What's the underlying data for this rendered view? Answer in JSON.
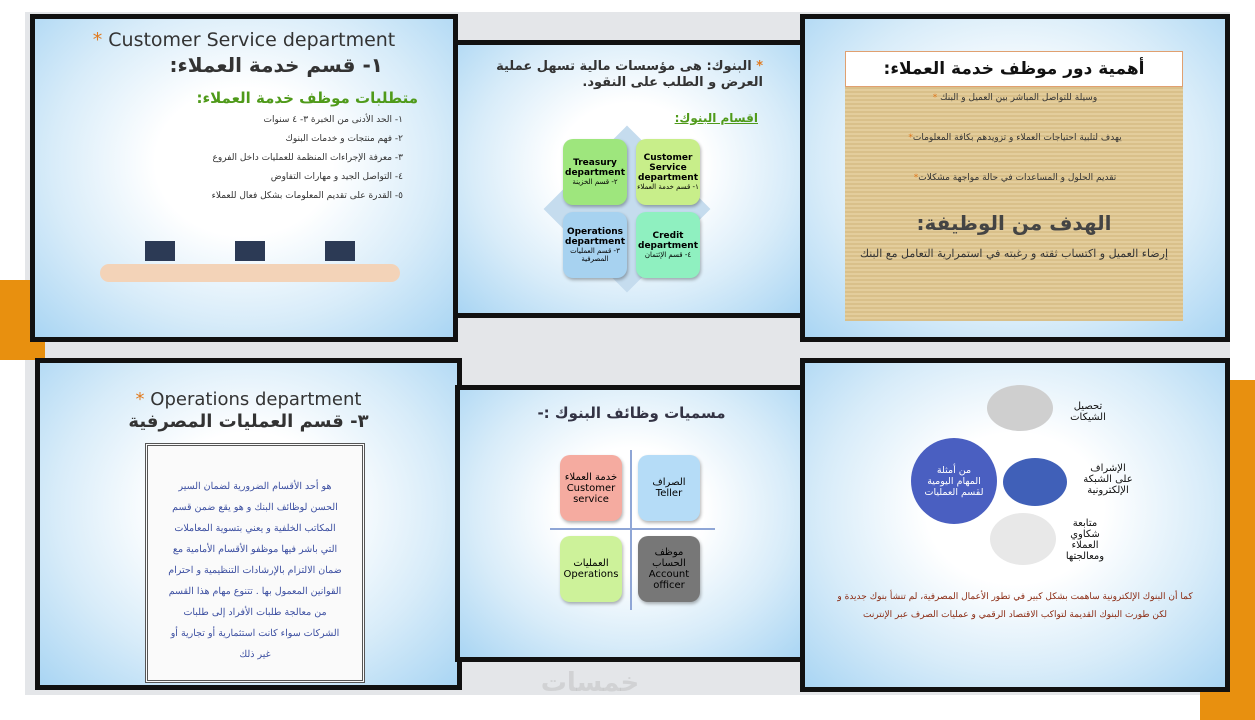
{
  "slide1": {
    "title_en": "Customer Service department",
    "title_ar": "١- قسم خدمة العملاء:",
    "subtitle": "متطلبات موظف خدمة العملاء:",
    "items": [
      "١- الحد الأدنى من الخبرة ٣- ٤ سنوات",
      "٢- فهم منتجات و خدمات البنوك",
      "٣- معرفة الإجراءات المنظمة للعمليات داخل الفروع",
      "٤- التواصل الجيد و مهارات التفاوض",
      "٥- القدرة على تقديم المعلومات بشكل فعال للعملاء"
    ]
  },
  "slide2": {
    "title": "البنوك: هى مؤسسات مالية تسهل عملية العرض و الطلب على النقود.",
    "subtitle": "اقسام البنوك:",
    "boxes": [
      {
        "en": "Customer Service department",
        "ar": "١- قسم خدمة العملاء",
        "color": "#c8ee8a"
      },
      {
        "en": "Treasury department",
        "ar": "٢- قسم الخزينة",
        "color": "#9ee67d"
      },
      {
        "en": "Operations department",
        "ar": "٣- قسم العمليات المصرفية",
        "color": "#a7d2f0"
      },
      {
        "en": "Credit department",
        "ar": "٤- قسم الإئتمان",
        "color": "#8ff0c0"
      }
    ]
  },
  "slide3": {
    "title": "أهمية دور موظف خدمة العملاء:",
    "items": [
      "وسيلة للتواصل المباشر بين العميل و البنك",
      "يهدف لتلبية احتياجات العملاء و تزويدهم بكافة المعلومات",
      "تقديم الحلول و المساعدات في حالة مواجهة مشكلات"
    ],
    "goal_title": "الهدف من الوظيفة:",
    "goal_text": "إرضاء العميل و اكتساب ثقته و رغبته في استمرارية التعامل مع البنك"
  },
  "slide4": {
    "title_en": "Operations department",
    "title_ar": "٣- قسم العمليات المصرفية",
    "body": "هو أحد الأقسام الضرورية لضمان السير الحسن لوظائف البنك و هو يقع ضمن قسم المكاتب الخلفية و يعني بتسوية المعاملات التي باشر فيها موظفو الأقسام الأمامية مع ضمان الالتزام بالإرشادات التنظيمية و احترام القوانين المعمول بها . تتنوع مهام هذا القسم من معالجة طلبات الأفراد إلى طلبات الشركات سواء كانت استثمارية أو تجارية أو غير ذلك"
  },
  "slide5": {
    "title": "مسميات وظائف البنوك :-",
    "boxes": [
      {
        "ar": "خدمة العملاء",
        "en": "Customer service",
        "color": "#f5aba0"
      },
      {
        "ar": "الصراف",
        "en": "Teller",
        "color": "#b5dcf7"
      },
      {
        "ar": "العمليات",
        "en": "Operations",
        "color": "#cdf29a"
      },
      {
        "ar": "موظف الحساب",
        "en": "Account officer",
        "color": "#777777"
      }
    ]
  },
  "slide6": {
    "center": "من أمثلة المهام اليومية لقسم العمليات",
    "tasks": [
      "تحصيل الشيكات",
      "الإشراف على الشبكة الإلكترونية",
      "متابعة شكاوي العملاء ومعالجتها"
    ],
    "footer": "كما أن البنوك الإلكترونية ساهمت بشكل كبير في تطور الأعمال المصرفية، لم تنشأ بنوك جديدة و لكن طورت البنوك القديمة لتواكب الاقتصاد الرقمي و عمليات الصرف عبر الإنترنت"
  },
  "watermark": "خمسات",
  "colors": {
    "accent": "#e8900f",
    "circle": "#4a5fc1"
  }
}
